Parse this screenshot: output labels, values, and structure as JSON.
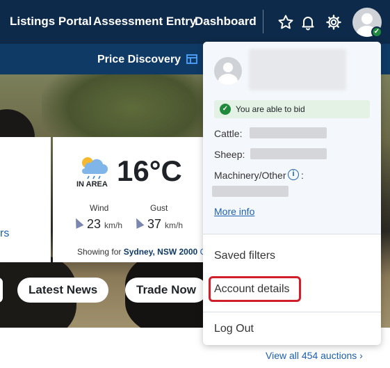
{
  "nav": {
    "links": [
      "Listings Portal",
      "Assessment Entry",
      "Dashboard"
    ],
    "icons": [
      "star-icon",
      "bell-icon",
      "gear-icon",
      "user-avatar"
    ]
  },
  "subnav": {
    "price_discovery": "Price Discovery"
  },
  "weather": {
    "temperature": "16°C",
    "in_area": "IN AREA",
    "wind_label": "Wind",
    "wind_value": "23",
    "wind_unit": "km/h",
    "gust_label": "Gust",
    "gust_value": "37",
    "gust_unit": "km/h",
    "showing_prefix": "Showing for",
    "location": "Sydney, NSW 2000",
    "location_fragment": "C"
  },
  "left_card": {
    "fragment": "rs"
  },
  "pills": {
    "latest_news": "Latest News",
    "trade_now": "Trade Now"
  },
  "footer": {
    "view_all": "View all 454 auctions",
    "chevron": "›"
  },
  "dropdown": {
    "bid_status": "You are able to bid",
    "cattle_label": "Cattle:",
    "sheep_label": "Sheep:",
    "machinery_label": "Machinery/Other",
    "machinery_suffix": ":",
    "more_info": "More info",
    "saved_filters": "Saved filters",
    "account_details": "Account details",
    "log_out": "Log Out"
  },
  "colors": {
    "nav_bg": "#0d2a4a",
    "subnav_bg": "#0f3a66",
    "link_blue": "#1b5fb0",
    "success_green": "#1f8a3b",
    "highlight_red": "#d01f2b"
  }
}
